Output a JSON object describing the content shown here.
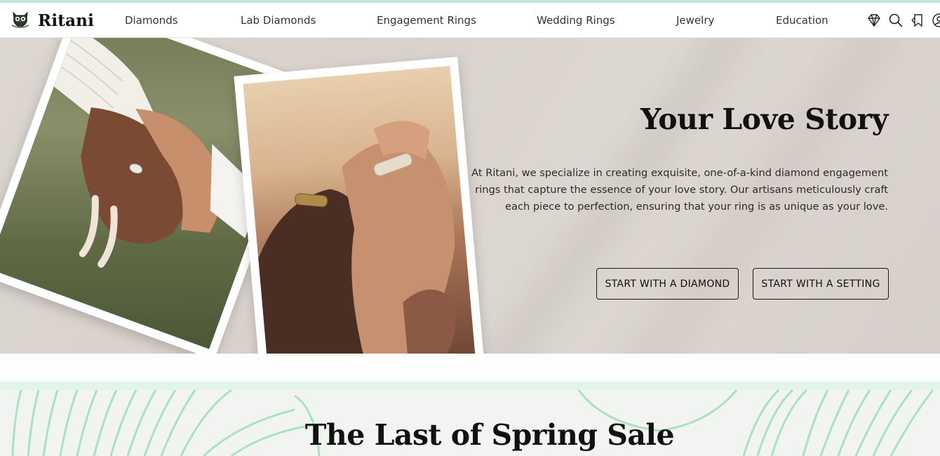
{
  "brand": {
    "name": "Ritani",
    "logo_icon": "owl-icon"
  },
  "nav": {
    "items": [
      {
        "label": "Diamonds"
      },
      {
        "label": "Lab Diamonds"
      },
      {
        "label": "Engagement Rings"
      },
      {
        "label": "Wedding Rings"
      },
      {
        "label": "Jewelry"
      },
      {
        "label": "Education"
      }
    ],
    "icons": [
      "diamond-icon",
      "search-icon",
      "bookmark-icon",
      "account-icon"
    ]
  },
  "hero": {
    "title": "Your Love Story",
    "text": "At Ritani, we specialize in creating exquisite, one-of-a-kind diamond engagement rings that capture the essence of your love story. Our artisans meticulously craft each piece to perfection, ensuring that your ring is as unique as your love.",
    "buttons": [
      {
        "label": "START WITH A DIAMOND"
      },
      {
        "label": "START WITH A SETTING"
      }
    ]
  },
  "sale": {
    "title": "The Last of Spring Sale"
  },
  "colors": {
    "accent": "#bfead2",
    "leaf": "#a9e2c2",
    "hero_bg": "#d9d3ce",
    "text": "#111111"
  }
}
